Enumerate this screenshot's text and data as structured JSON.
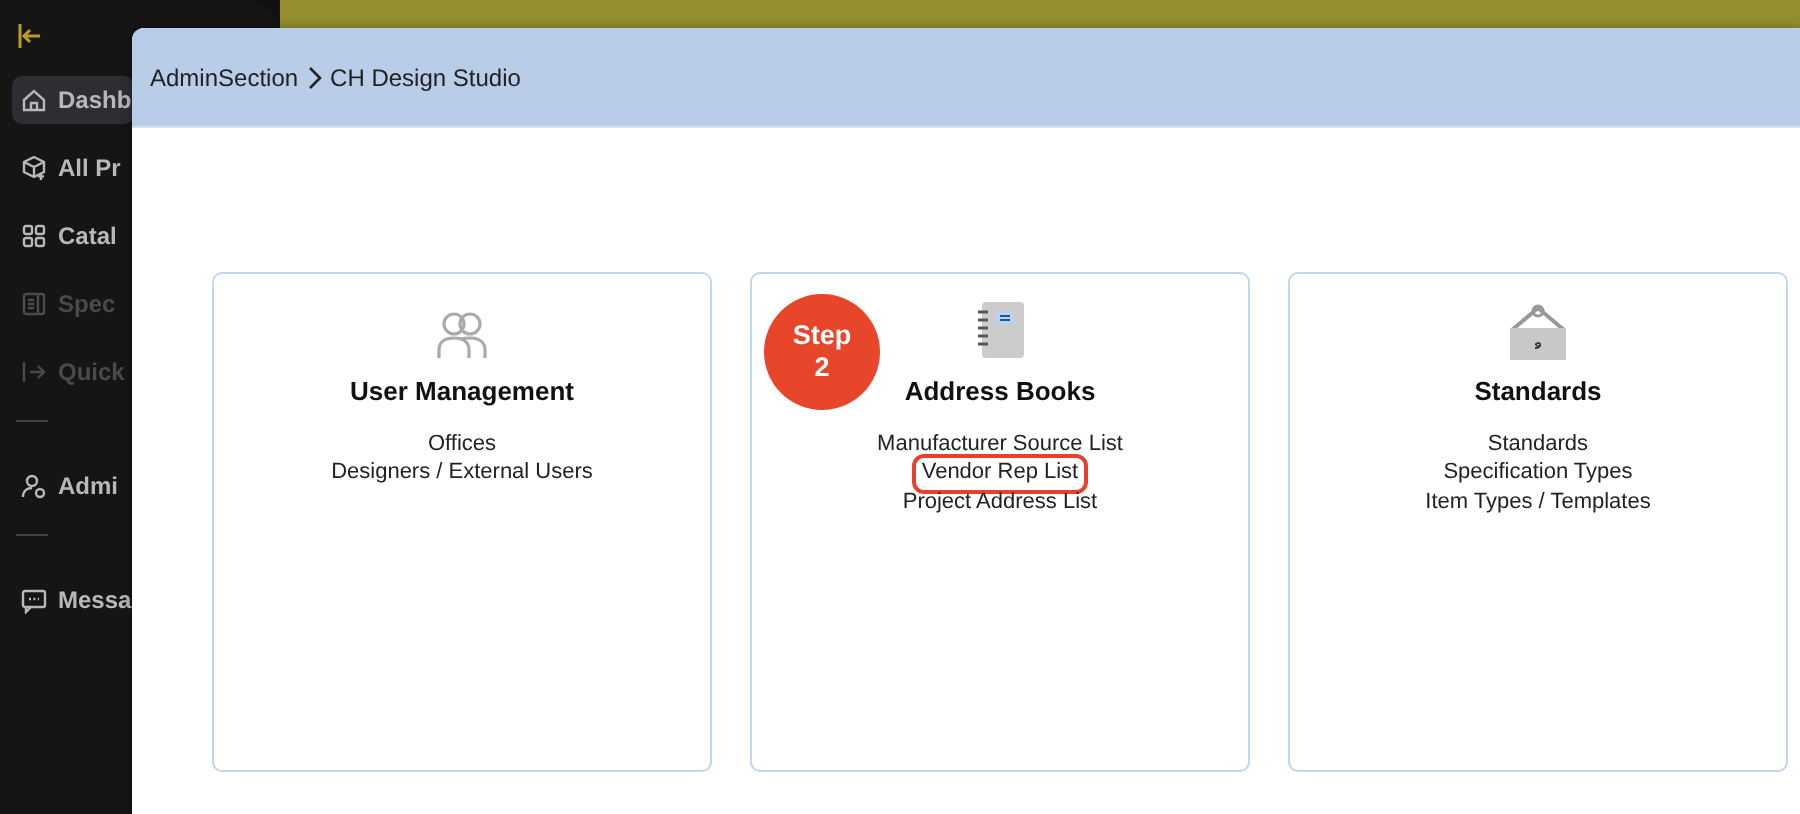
{
  "sidebar": {
    "items": [
      {
        "kind": "link",
        "label": "Dashb",
        "selected": true,
        "disabled": false
      },
      {
        "kind": "link",
        "label": "All Pr",
        "selected": false,
        "disabled": false
      },
      {
        "kind": "link",
        "label": "Catal",
        "selected": false,
        "disabled": false
      },
      {
        "kind": "link",
        "label": "Spec",
        "selected": false,
        "disabled": true
      },
      {
        "kind": "link",
        "label": "Quick",
        "selected": false,
        "disabled": true
      },
      {
        "kind": "divider"
      },
      {
        "kind": "link",
        "label": "Admi",
        "selected": false,
        "disabled": false
      },
      {
        "kind": "divider"
      },
      {
        "kind": "link",
        "label": "Messa",
        "selected": false,
        "disabled": false
      }
    ]
  },
  "modal": {
    "breadcrumb": [
      "AdminSection",
      "CH Design Studio"
    ],
    "cards": [
      {
        "title": "User Management",
        "links": [
          {
            "label": "Offices",
            "highlighted": false
          },
          {
            "label": "Designers / External Users",
            "highlighted": false
          }
        ]
      },
      {
        "title": "Address Books",
        "badge": "Step 2",
        "links": [
          {
            "label": "Manufacturer Source List",
            "highlighted": false
          },
          {
            "label": "Vendor Rep List",
            "highlighted": true
          },
          {
            "label": "Project Address List",
            "highlighted": false
          }
        ]
      },
      {
        "title": "Standards",
        "links": [
          {
            "label": "Standards",
            "highlighted": false
          },
          {
            "label": "Specification Types",
            "highlighted": false
          },
          {
            "label": "Item Types / Templates",
            "highlighted": false
          }
        ]
      }
    ]
  }
}
